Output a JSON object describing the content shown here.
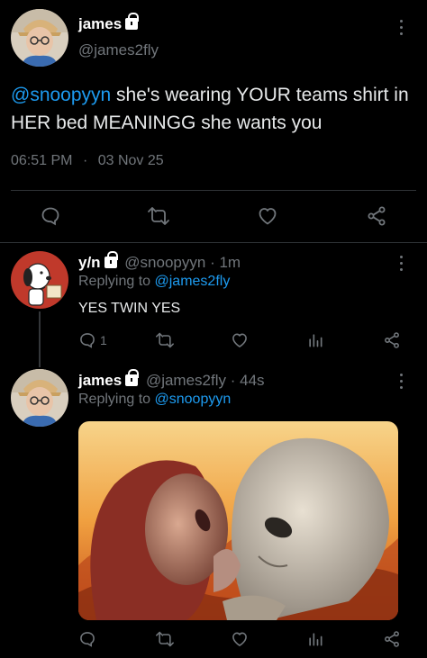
{
  "main_tweet": {
    "name": "james",
    "handle": "@james2fly",
    "mention": "@snoopyyn",
    "text_line1": " she's wearing YOUR teams shirt in",
    "text_line2": "HER bed MEANINGG she wants you",
    "time": "06:51 PM",
    "dot": "·",
    "date": "03 Nov 25"
  },
  "reply1": {
    "name": "y/n",
    "handle": "@snoopyyn",
    "sep": "·",
    "age": "1m",
    "replying_prefix": "Replying to ",
    "replying_to": "@james2fly",
    "text": "YES TWIN YES",
    "reply_count": "1"
  },
  "reply2": {
    "name": "james",
    "handle": "@james2fly",
    "sep": "·",
    "age": "44s",
    "replying_prefix": "Replying to ",
    "replying_to": "@snoopyyn"
  },
  "colors": {
    "background": "#000000",
    "text": "#e7e9ea",
    "secondary": "#71767b",
    "link": "#1d9bf0",
    "divider": "#2f3336"
  },
  "icons": [
    "reply-icon",
    "retweet-icon",
    "like-icon",
    "views-icon",
    "share-icon",
    "lock-icon",
    "more-icon"
  ]
}
